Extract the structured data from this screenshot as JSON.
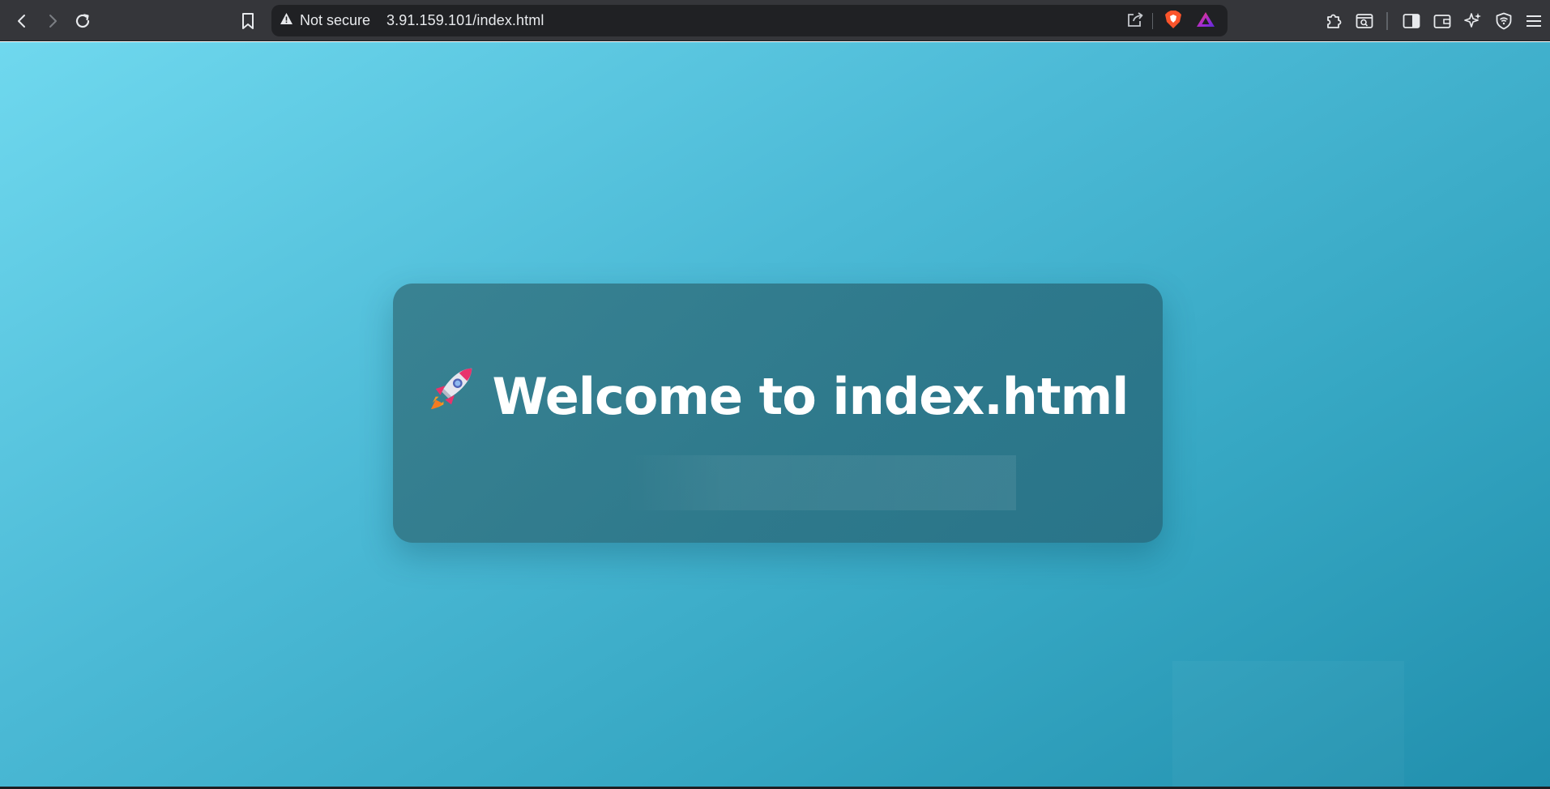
{
  "browser": {
    "security_label": "Not secure",
    "url": "3.91.159.101/index.html",
    "icons": {
      "back": "back-arrow-icon",
      "forward": "forward-arrow-icon",
      "reload": "reload-icon",
      "bookmark": "bookmark-icon",
      "warning": "warning-triangle-icon",
      "share": "share-icon",
      "brave_shields": "brave-lion-icon",
      "brave_rewards": "brave-rewards-triangle-icon",
      "extensions": "puzzle-piece-icon",
      "search_page": "search-page-icon",
      "sidebar": "sidebar-icon",
      "wallet": "wallet-icon",
      "leo": "sparkle-icon",
      "vpn": "vpn-shield-icon",
      "menu": "hamburger-menu-icon"
    }
  },
  "page": {
    "heading_emoji": "🚀",
    "heading_text": "Welcome to index.html"
  },
  "colors": {
    "chrome_bg": "#35363a",
    "omnibox_bg": "#202124",
    "page_gradient_start": "#6fd8ee",
    "page_gradient_end": "#218fad",
    "card_bg": "#2f7688",
    "heading_color": "#ffffff",
    "brave_orange": "#fb542b"
  }
}
